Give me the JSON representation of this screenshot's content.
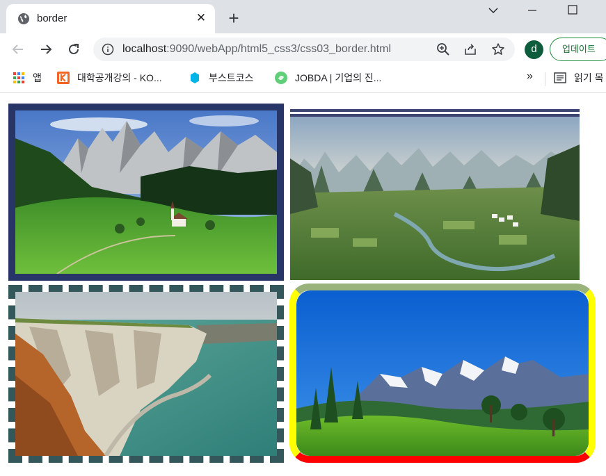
{
  "browser": {
    "tab": {
      "title": "border",
      "favicon": "globe-icon"
    },
    "new_tab_label": "+",
    "address": {
      "host": "localhost",
      "path": ":9090/webApp/html5_css3/css03_border.html"
    },
    "profile_initial": "d",
    "update_label": "업데이트",
    "bookmarks": [
      {
        "label": "앱",
        "icon": "apps-grid-icon"
      },
      {
        "label": "대학공개강의 - KO...",
        "icon": "kocw-icon"
      },
      {
        "label": "부스트코스",
        "icon": "boostcourse-icon"
      },
      {
        "label": "JOBDA | 기업의 진...",
        "icon": "jobda-icon"
      }
    ],
    "bookmarks_more": "»",
    "reading_list_label": "읽기 목"
  },
  "page": {
    "images": [
      {
        "name": "alpine-valley-photo",
        "border": "solid"
      },
      {
        "name": "karst-mountains-photo",
        "border": "double-top"
      },
      {
        "name": "sea-cliff-photo",
        "border": "dashed"
      },
      {
        "name": "snowy-mountains-photo",
        "border": "mixed-color-rounded"
      }
    ],
    "colors": {
      "solid_border": "#273666",
      "double_border": "#3c4670",
      "dashed_border": "#34575c",
      "rounded_top": "#9ab27b",
      "rounded_sides": "#ffff00",
      "rounded_bottom": "#ff0000"
    }
  }
}
